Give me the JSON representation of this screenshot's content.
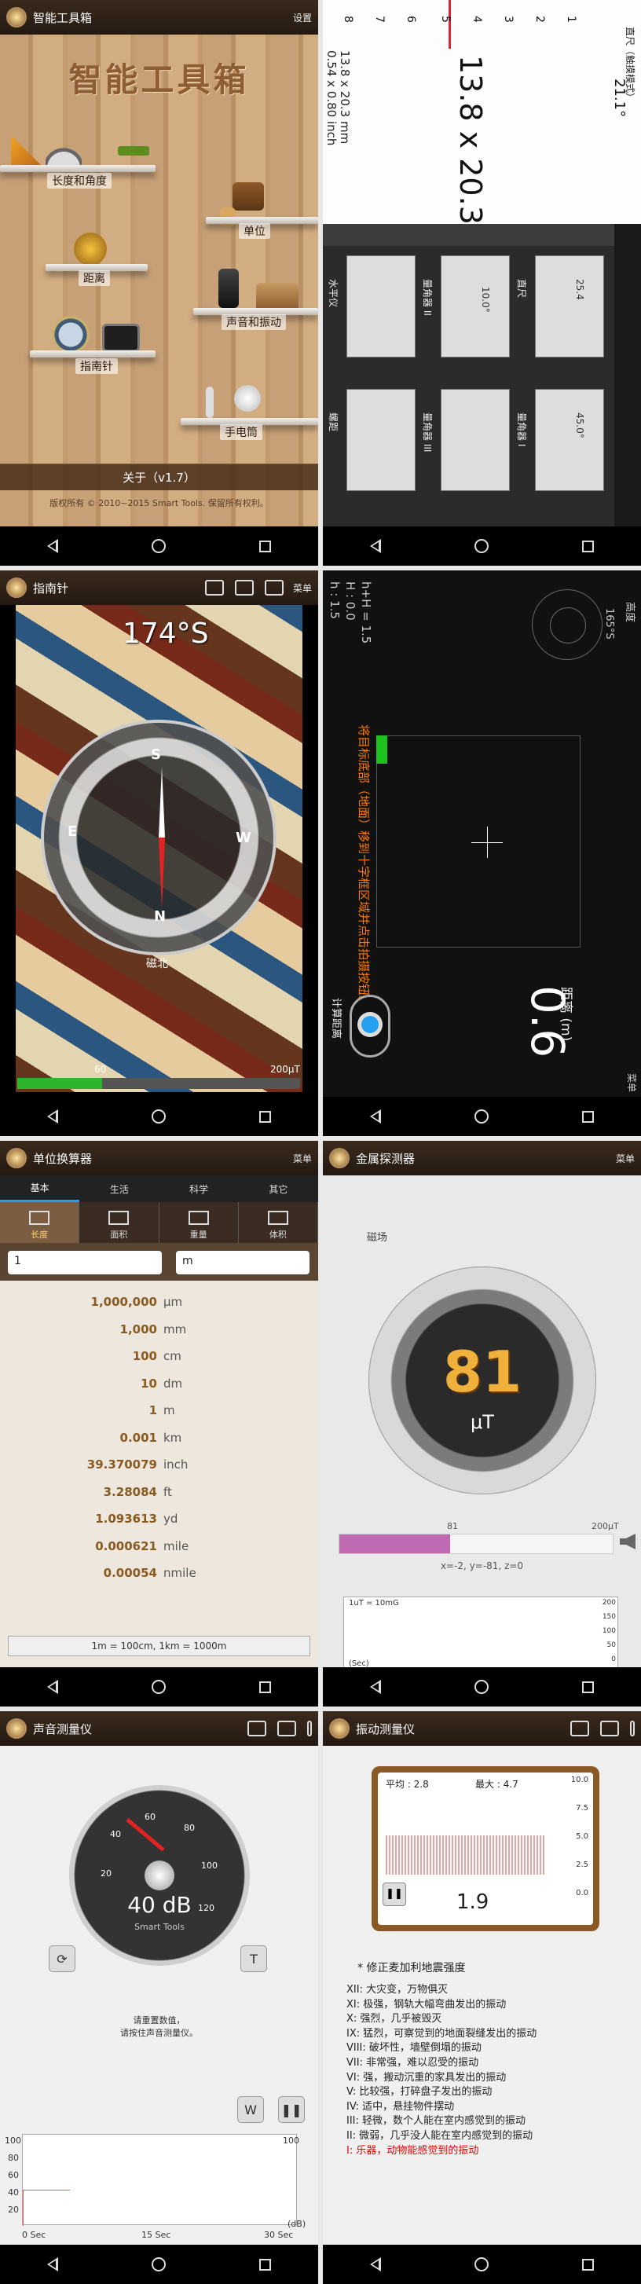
{
  "home": {
    "title": "智能工具箱",
    "settings_label": "设置",
    "logo_text": "智能工具箱",
    "items": [
      "长度和角度",
      "单位",
      "距离",
      "声音和振动",
      "指南针",
      "手电筒"
    ],
    "about_label": "关于（v1.7）",
    "copyright": "版权所有 © 2010~2015 Smart Tools. 保留所有权利。"
  },
  "ruler": {
    "header": "直尺（触摸模式）",
    "size_big": "13.8 x 20.3",
    "size_small": "13.8 x 20.3 mm\n0.54 x 0.80 inch",
    "ruler_value": "21.1°",
    "scale_numbers": [
      "8",
      "7",
      "6",
      "5",
      "4",
      "3",
      "2",
      "1"
    ],
    "tool_labels": [
      "水平仪",
      "量角器 II",
      "直尺",
      "螺距",
      "量角器 III",
      "量角器 I"
    ],
    "tool_values": [
      "10.0°",
      "25.4",
      "45.0°"
    ]
  },
  "compass": {
    "title": "指南针",
    "menu_label": "菜单",
    "heading": "174°S",
    "directions": [
      "S",
      "E",
      "W",
      "N"
    ],
    "magnetic_label": "磁北",
    "progress_value_label": "60",
    "progress_max_label": "200μT",
    "progress_fraction": 0.3
  },
  "distance": {
    "hdr": "高度",
    "menu_label": "菜单",
    "h_line": "h : 1.5",
    "H_line": "H : 0.0",
    "hH_line": "h+H = 1.5",
    "radar_label": "165°S",
    "instructions": "将目标底部（地面）移到十字框区域并点击拍摄按钮。",
    "distance_label": "距离 (m)",
    "distance_value": "0.6",
    "calc_label": "计算距离"
  },
  "units": {
    "title": "单位换算器",
    "menu_label": "菜单",
    "tabs": [
      "基本",
      "生活",
      "科学",
      "其它"
    ],
    "subtabs": [
      "长度",
      "面积",
      "重量",
      "体积"
    ],
    "input_value": "1",
    "unit_select": "m",
    "rows": [
      {
        "value": "1,000,000",
        "unit": "μm"
      },
      {
        "value": "1,000",
        "unit": "mm"
      },
      {
        "value": "100",
        "unit": "cm"
      },
      {
        "value": "10",
        "unit": "dm"
      },
      {
        "value": "1",
        "unit": "m"
      },
      {
        "value": "0.001",
        "unit": "km"
      },
      {
        "value": "39.370079",
        "unit": "inch"
      },
      {
        "value": "3.28084",
        "unit": "ft"
      },
      {
        "value": "1.093613",
        "unit": "yd"
      },
      {
        "value": "0.000621",
        "unit": "mile"
      },
      {
        "value": "0.00054",
        "unit": "nmile"
      }
    ],
    "note": "1m = 100cm, 1km = 1000m"
  },
  "metal": {
    "title": "金属探测器",
    "menu_label": "菜单",
    "field_label": "磁场",
    "value": "81",
    "unit": "μT",
    "bar_value_label": "81",
    "bar_max_label": "200μT",
    "bar_fraction": 0.405,
    "xyz": "x=-2, y=-81, z=0",
    "graph_legend": "1uT = 10mG",
    "graph_axis": [
      "200",
      "150",
      "100",
      "50",
      "0"
    ],
    "graph_xlabel": "(Sec)"
  },
  "sound": {
    "title": "声音测量仪",
    "value": "40 dB",
    "brand": "Smart Tools",
    "scale": [
      "20",
      "40",
      "60",
      "80",
      "100",
      "120"
    ],
    "hint": "请重置数值，\n请按住声音测量仪。",
    "chart_y": [
      "100",
      "80",
      "60",
      "40",
      "20"
    ],
    "chart_x": [
      "0 Sec",
      "15 Sec",
      "30 Sec"
    ],
    "chart_unit": "(dB)"
  },
  "vibration": {
    "title": "振动测量仪",
    "avg": "平均 : 2.8",
    "max": "最大 : 4.7",
    "value": "1.9",
    "scale": [
      "10.0",
      "7.5",
      "5.0",
      "2.5",
      "0.0"
    ],
    "note": "* 修正麦加利地震强度",
    "levels": [
      "XII: 大灾变，万物俱灭",
      "XI: 极强，钢轨大幅弯曲发出的振动",
      "X: 强烈，几乎被毁灭",
      "IX: 猛烈，可察觉到的地面裂缝发出的振动",
      "VIII: 破坏性，墙壁倒塌的振动",
      "VII: 非常强，难以忍受的振动",
      "VI: 强，搬动沉重的家具发出的振动",
      "V: 比较强，打碎盘子发出的振动",
      "IV: 适中，悬挂物件摆动",
      "III: 轻微，数个人能在室内感觉到的振动",
      "II: 微弱，几乎没人能在室内感觉到的振动",
      "I: 乐器，动物能感觉到的振动"
    ]
  }
}
